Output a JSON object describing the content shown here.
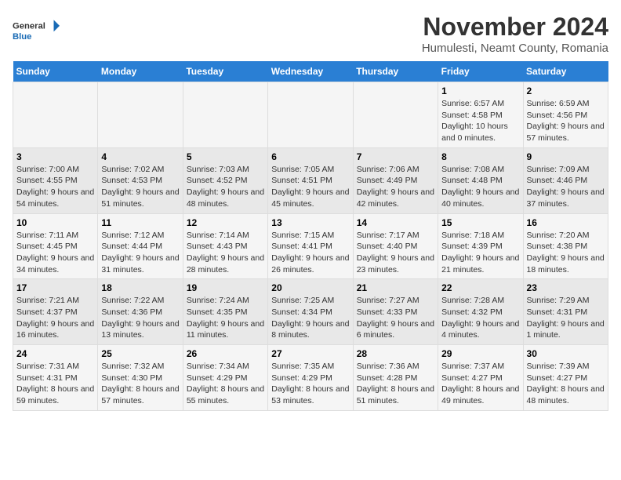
{
  "logo": {
    "text_general": "General",
    "text_blue": "Blue"
  },
  "title": "November 2024",
  "subtitle": "Humulesti, Neamt County, Romania",
  "weekdays": [
    "Sunday",
    "Monday",
    "Tuesday",
    "Wednesday",
    "Thursday",
    "Friday",
    "Saturday"
  ],
  "weeks": [
    [
      {
        "day": "",
        "info": ""
      },
      {
        "day": "",
        "info": ""
      },
      {
        "day": "",
        "info": ""
      },
      {
        "day": "",
        "info": ""
      },
      {
        "day": "",
        "info": ""
      },
      {
        "day": "1",
        "info": "Sunrise: 6:57 AM\nSunset: 4:58 PM\nDaylight: 10 hours and 0 minutes."
      },
      {
        "day": "2",
        "info": "Sunrise: 6:59 AM\nSunset: 4:56 PM\nDaylight: 9 hours and 57 minutes."
      }
    ],
    [
      {
        "day": "3",
        "info": "Sunrise: 7:00 AM\nSunset: 4:55 PM\nDaylight: 9 hours and 54 minutes."
      },
      {
        "day": "4",
        "info": "Sunrise: 7:02 AM\nSunset: 4:53 PM\nDaylight: 9 hours and 51 minutes."
      },
      {
        "day": "5",
        "info": "Sunrise: 7:03 AM\nSunset: 4:52 PM\nDaylight: 9 hours and 48 minutes."
      },
      {
        "day": "6",
        "info": "Sunrise: 7:05 AM\nSunset: 4:51 PM\nDaylight: 9 hours and 45 minutes."
      },
      {
        "day": "7",
        "info": "Sunrise: 7:06 AM\nSunset: 4:49 PM\nDaylight: 9 hours and 42 minutes."
      },
      {
        "day": "8",
        "info": "Sunrise: 7:08 AM\nSunset: 4:48 PM\nDaylight: 9 hours and 40 minutes."
      },
      {
        "day": "9",
        "info": "Sunrise: 7:09 AM\nSunset: 4:46 PM\nDaylight: 9 hours and 37 minutes."
      }
    ],
    [
      {
        "day": "10",
        "info": "Sunrise: 7:11 AM\nSunset: 4:45 PM\nDaylight: 9 hours and 34 minutes."
      },
      {
        "day": "11",
        "info": "Sunrise: 7:12 AM\nSunset: 4:44 PM\nDaylight: 9 hours and 31 minutes."
      },
      {
        "day": "12",
        "info": "Sunrise: 7:14 AM\nSunset: 4:43 PM\nDaylight: 9 hours and 28 minutes."
      },
      {
        "day": "13",
        "info": "Sunrise: 7:15 AM\nSunset: 4:41 PM\nDaylight: 9 hours and 26 minutes."
      },
      {
        "day": "14",
        "info": "Sunrise: 7:17 AM\nSunset: 4:40 PM\nDaylight: 9 hours and 23 minutes."
      },
      {
        "day": "15",
        "info": "Sunrise: 7:18 AM\nSunset: 4:39 PM\nDaylight: 9 hours and 21 minutes."
      },
      {
        "day": "16",
        "info": "Sunrise: 7:20 AM\nSunset: 4:38 PM\nDaylight: 9 hours and 18 minutes."
      }
    ],
    [
      {
        "day": "17",
        "info": "Sunrise: 7:21 AM\nSunset: 4:37 PM\nDaylight: 9 hours and 16 minutes."
      },
      {
        "day": "18",
        "info": "Sunrise: 7:22 AM\nSunset: 4:36 PM\nDaylight: 9 hours and 13 minutes."
      },
      {
        "day": "19",
        "info": "Sunrise: 7:24 AM\nSunset: 4:35 PM\nDaylight: 9 hours and 11 minutes."
      },
      {
        "day": "20",
        "info": "Sunrise: 7:25 AM\nSunset: 4:34 PM\nDaylight: 9 hours and 8 minutes."
      },
      {
        "day": "21",
        "info": "Sunrise: 7:27 AM\nSunset: 4:33 PM\nDaylight: 9 hours and 6 minutes."
      },
      {
        "day": "22",
        "info": "Sunrise: 7:28 AM\nSunset: 4:32 PM\nDaylight: 9 hours and 4 minutes."
      },
      {
        "day": "23",
        "info": "Sunrise: 7:29 AM\nSunset: 4:31 PM\nDaylight: 9 hours and 1 minute."
      }
    ],
    [
      {
        "day": "24",
        "info": "Sunrise: 7:31 AM\nSunset: 4:31 PM\nDaylight: 8 hours and 59 minutes."
      },
      {
        "day": "25",
        "info": "Sunrise: 7:32 AM\nSunset: 4:30 PM\nDaylight: 8 hours and 57 minutes."
      },
      {
        "day": "26",
        "info": "Sunrise: 7:34 AM\nSunset: 4:29 PM\nDaylight: 8 hours and 55 minutes."
      },
      {
        "day": "27",
        "info": "Sunrise: 7:35 AM\nSunset: 4:29 PM\nDaylight: 8 hours and 53 minutes."
      },
      {
        "day": "28",
        "info": "Sunrise: 7:36 AM\nSunset: 4:28 PM\nDaylight: 8 hours and 51 minutes."
      },
      {
        "day": "29",
        "info": "Sunrise: 7:37 AM\nSunset: 4:27 PM\nDaylight: 8 hours and 49 minutes."
      },
      {
        "day": "30",
        "info": "Sunrise: 7:39 AM\nSunset: 4:27 PM\nDaylight: 8 hours and 48 minutes."
      }
    ]
  ]
}
